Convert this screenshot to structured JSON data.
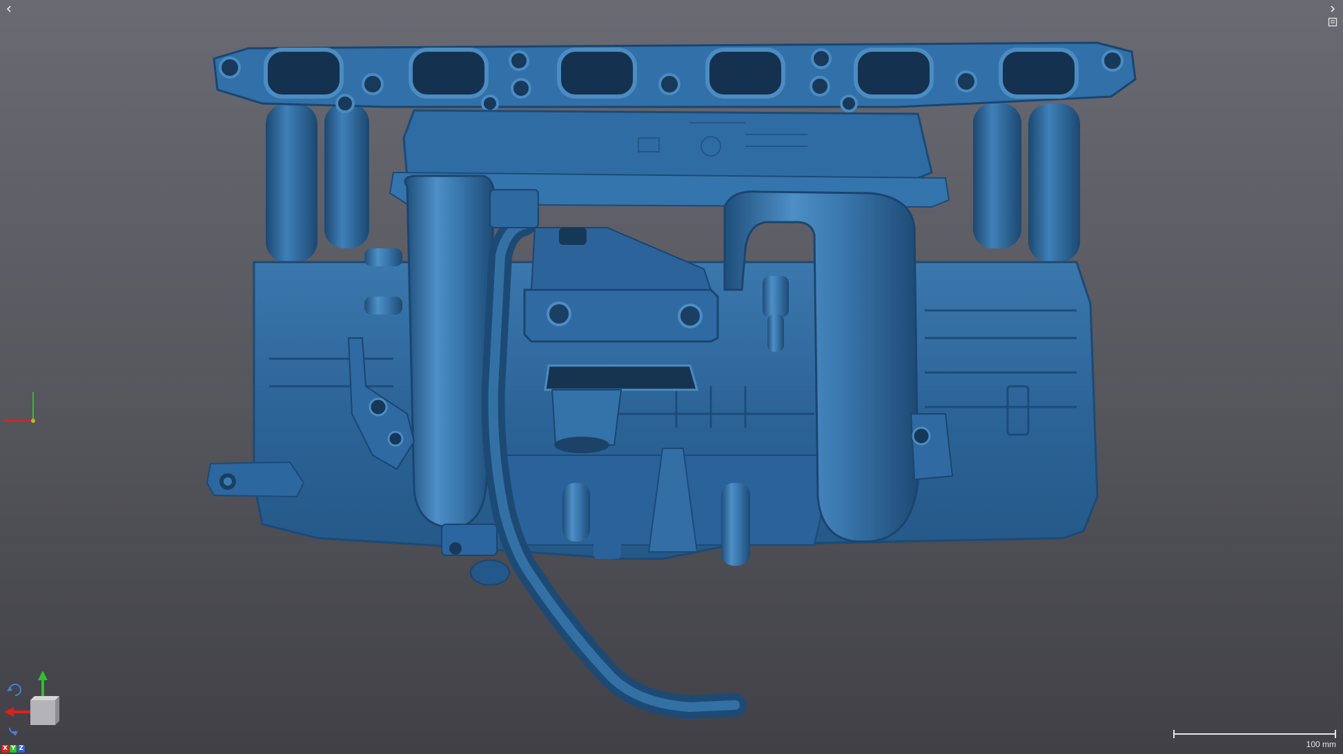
{
  "viewer": {
    "background_top": "#6a6a73",
    "background_bottom": "#404046",
    "model_color": "#2f6a9e"
  },
  "controls": {
    "collapse_left_icon": "chevron-left-icon",
    "collapse_right_icon": "chevron-right-icon",
    "panel_toggle_icon": "panel-icon"
  },
  "axes": {
    "x_color": "#e0201c",
    "y_color": "#2ec12e",
    "z_color": "#2f5fd0",
    "labels": {
      "x": "X",
      "y": "Y",
      "z": "Z"
    }
  },
  "scale": {
    "label": "100 mm"
  }
}
